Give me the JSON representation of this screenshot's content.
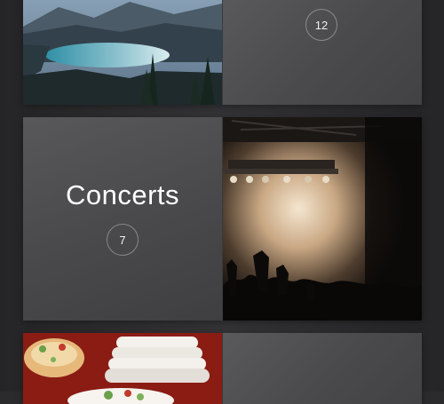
{
  "albums": [
    {
      "title": "",
      "count": "12",
      "photo": "lake-mountain-photo"
    },
    {
      "title": "Concerts",
      "count": "7",
      "photo": "concert-crowd-photo"
    },
    {
      "title": "",
      "count": "",
      "photo": "food-plates-photo"
    }
  ]
}
